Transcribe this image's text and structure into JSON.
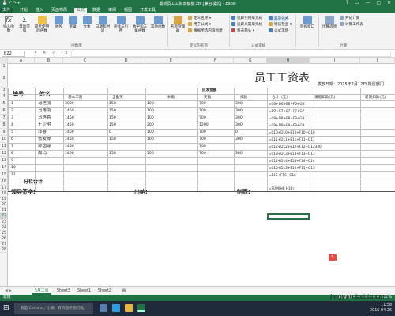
{
  "window": {
    "title": "最新员工工资表模板.xls [兼容模式] - Excel",
    "quick_access": "💾 ↶ ↷ ▾",
    "controls": "?  ▭  —  ▢  ✕"
  },
  "ribbon_tabs": [
    "文件",
    "开始",
    "插入",
    "页面布局",
    "公式",
    "数据",
    "审阅",
    "视图",
    "开发工具"
  ],
  "active_tab": "公式",
  "ribbon": {
    "big_buttons": [
      "插入函数",
      "自动求和",
      "最近使用的函数",
      "财务",
      "逻辑",
      "文本",
      "日期和时间",
      "查找与引用",
      "数学和三角函数",
      "其他函数",
      "名称管理器"
    ],
    "defined_names": [
      "定义名称 ▾",
      "用于公式 ▾",
      "根据所选内容创建"
    ],
    "auditing": [
      "追踪引用单元格",
      "追踪从属单元格",
      "移去箭头 ▾",
      "显示公式",
      "错误检查 ▾",
      "公式求值"
    ],
    "watch": "监视窗口",
    "calc_options": "计算选项",
    "calc_small": [
      "开始计算",
      "计算工作表"
    ],
    "groups": [
      "函数库",
      "定义的名称",
      "公式审核",
      "计算"
    ]
  },
  "formula_bar": {
    "name_box": "B22",
    "buttons": "▾  ✕  ✓  fx",
    "value": ""
  },
  "columns": [
    "A",
    "B",
    "C",
    "D",
    "E",
    "F",
    "G",
    "H",
    "I",
    "J"
  ],
  "selected_column": "H",
  "rows": [
    "1",
    "2",
    "3",
    "4",
    "5",
    "6",
    "7",
    "8",
    "9",
    "10",
    "11",
    "12",
    "13",
    "14",
    "15",
    "16",
    "17",
    "18",
    "19",
    "20",
    "21",
    "22",
    "23",
    "24",
    "25",
    "26",
    "27",
    "28"
  ],
  "selected_row": "22",
  "sheet": {
    "title": "员工工资表",
    "date_label": "发放日期：2015年2月12日 所属部门",
    "header_group": "应发金额",
    "col_num": "编号",
    "col_name": "姓名",
    "sub_headers": [
      "基本工资",
      "全勤奖",
      "补助",
      "奖励",
      "扣款",
      "合计（元）",
      "请假扣款(元)",
      "迟到扣款(元)"
    ],
    "rows": [
      {
        "no": "1",
        "name": "马莲丽",
        "base": "3000",
        "full": "150",
        "allow": "100",
        "bonus": "700",
        "deduct": "300",
        "formula": "=C6+D6+E6+F6+G6"
      },
      {
        "no": "2",
        "name": "马莲南",
        "base": "1450",
        "full": "150",
        "allow": "100",
        "bonus": "700",
        "deduct": "300",
        "formula": "=D7+C7+E7+F7+G7"
      },
      {
        "no": "3",
        "name": "马莲喜",
        "base": "1450",
        "full": "150",
        "allow": "100",
        "bonus": "700",
        "deduct": "300",
        "formula": "=C8+D8+E8+F8+G8"
      },
      {
        "no": "4",
        "name": "王卫明",
        "base": "1450",
        "full": "150",
        "allow": "200",
        "bonus": "1200",
        "deduct": "300",
        "formula": "=C9+D9+E9+F9+G9"
      },
      {
        "no": "5",
        "name": "邓睿",
        "base": "1450",
        "full": "0",
        "allow": "100",
        "bonus": "700",
        "deduct": "0",
        "formula": "=C10+D10+E10+F10+G10"
      },
      {
        "no": "6",
        "name": "张爱琴",
        "base": "1450",
        "full": "150",
        "allow": "100",
        "bonus": "700",
        "deduct": "300",
        "formula": "=C11+D11+E11+F11+G11"
      },
      {
        "no": "7",
        "name": "郭国琼",
        "base": "1450",
        "full": "",
        "allow": "",
        "bonus": "700",
        "deduct": "",
        "formula": "=C12+D12+E12+F12+G12330"
      },
      {
        "no": "8",
        "name": "周玛",
        "base": "1450",
        "full": "150",
        "allow": "100",
        "bonus": "700",
        "deduct": "300",
        "formula": "=C13+D13+E13+F13+G13"
      },
      {
        "no": "9",
        "name": "",
        "base": "",
        "full": "",
        "allow": "",
        "bonus": "",
        "deduct": "",
        "formula": "=C14+D14+E14+F14+G14"
      },
      {
        "no": "10",
        "name": "",
        "base": "",
        "full": "",
        "allow": "",
        "bonus": "",
        "deduct": "",
        "formula": "=C15+D15+E15+F15+G15"
      },
      {
        "no": "11",
        "name": "",
        "base": "",
        "full": "",
        "allow": "",
        "bonus": "",
        "deduct": "",
        "formula": "=E16+F16+G16"
      }
    ],
    "subtotal_label": "分栏合计",
    "subtotal_formula": "=SUM(H6:H16)",
    "sign_leader": "领导签字:",
    "sign_cashier": "出纳:",
    "sign_maker": "制表:"
  },
  "sheet_tabs": [
    "5月工资",
    "Sheet3",
    "Sheet1",
    "Sheet2"
  ],
  "active_sheet": "5月工资",
  "status": {
    "left": "就绪",
    "right": "▦  ▤  ▥  −  ——+——  +  100%"
  },
  "taskbar": {
    "search": "我是 Cortana，小娜。有问题尽管问我。",
    "time": "11:58",
    "date": "2016-04-26"
  },
  "watermark": "jingyan.baidu.com",
  "colors": {
    "excel_green": "#217346",
    "ribbon_bg": "#f3f3f3",
    "taskbar": "#1f2b3a"
  }
}
